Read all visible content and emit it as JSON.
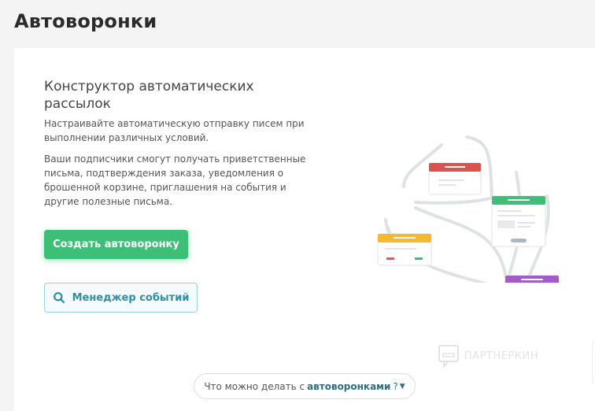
{
  "header": {
    "title": "Автоворонки"
  },
  "card": {
    "title": "Конструктор автоматических рассылок",
    "description_1": "Настраивайте автоматическую отправку писем при выполнении различных условий.",
    "description_2": "Ваши подписчики смогут получать приветственные письма, подтверждения заказа, уведомления о брошенной корзине, приглашения на события и другие полезные письма.",
    "create_button": "Создать автоворонку",
    "events_button": {
      "label": "Менеджер событий",
      "icon": "search-icon"
    }
  },
  "watermark": {
    "text": "ПАРТНЕРКИН"
  },
  "faq": {
    "prefix": "Что можно делать с",
    "highlight": "автоворонками",
    "suffix": "?"
  },
  "illustration": {
    "card_colors": [
      "#d9534f",
      "#3dbf78",
      "#f5b82e",
      "#a45bc8",
      "#1a8ccb"
    ],
    "connector_color": "#dde3e5"
  }
}
